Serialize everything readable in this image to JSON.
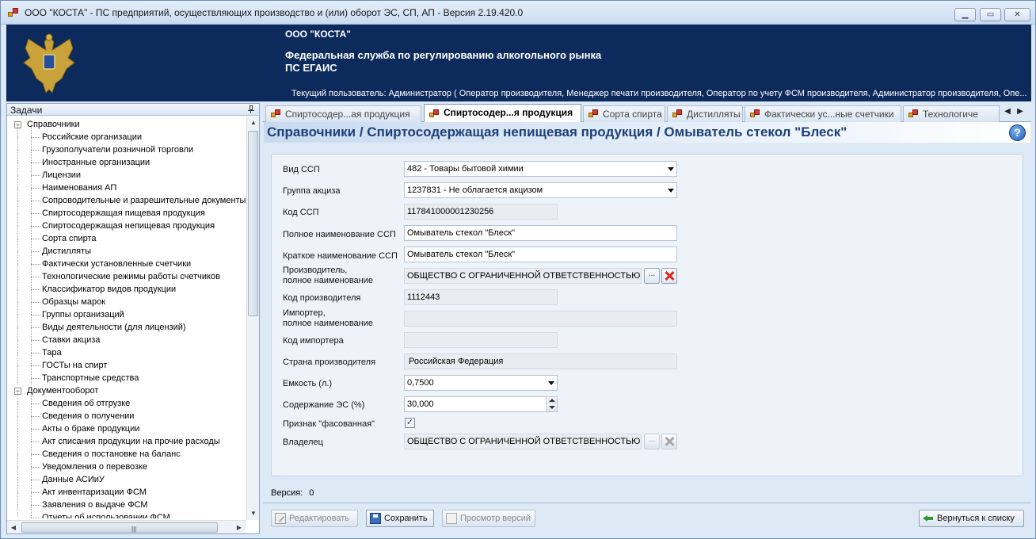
{
  "window": {
    "title": "ООО \"КОСТА\" - ПС предприятий, осуществляющих производство и (или) оборот ЭС, СП, АП - Версия 2.19.420.0",
    "min_label": "▁",
    "max_label": "▭",
    "close_label": "✕"
  },
  "header": {
    "company": "ООО \"КОСТА\"",
    "agency": "Федеральная служба по регулированию алкогольного рынка",
    "system": "ПС ЕГАИС",
    "current_user": "Текущий пользователь: Администратор ( Оператор производителя, Менеджер печати производителя, Оператор по учету ФСМ производителя, Администратор производителя, Опе..."
  },
  "tasks": {
    "title": "Задачи",
    "groups": [
      {
        "label": "Справочники",
        "expander": "−",
        "items": [
          "Российские организации",
          "Грузополучатели розничной торговли",
          "Иностранные организации",
          "Лицензии",
          "Наименования АП",
          "Сопроводительные и разрешительные документы",
          "Спиртосодержащая пищевая продукция",
          "Спиртосодержащая непищевая продукция",
          "Сорта спирта",
          "Дистилляты",
          "Фактически установленные счетчики",
          "Технологические режимы работы счетчиков",
          "Классификатор видов продукции",
          "Образцы марок",
          "Группы организаций",
          "Виды деятельности (для лицензий)",
          "Ставки акциза",
          "Тара",
          "ГОСТы на спирт",
          "Транспортные средства"
        ]
      },
      {
        "label": "Документооборот",
        "expander": "−",
        "items": [
          "Сведения об отгрузке",
          "Сведения о получении",
          "Акты о браке продукции",
          "Акт списания продукции на прочие расходы",
          "Сведения о постановке на баланс",
          "Уведомления о перевозке",
          "Данные АСИиУ",
          "Акт инвентаризации ФСМ",
          "Заявления о выдаче ФСМ",
          "Отчеты об использовании ФСМ"
        ]
      }
    ],
    "scroll": {
      "up": "▲",
      "down": "▼",
      "left": "◀",
      "right": "▶",
      "grip": "|||"
    }
  },
  "tabs": [
    {
      "label": "Спиртосодер...ая продукция",
      "active": false
    },
    {
      "label": "Спиртосодер...я продукция",
      "active": true
    },
    {
      "label": "Сорта спирта",
      "active": false
    },
    {
      "label": "Дистилляты",
      "active": false
    },
    {
      "label": "Фактически ус...ные счетчики",
      "active": false
    },
    {
      "label": "Технологиче",
      "active": false
    }
  ],
  "tab_nav": {
    "prev": "◀",
    "next": "▶"
  },
  "breadcrumb": "Справочники / Спиртосодержащая непищевая продукция / Омыватель стекол \"Блеск\"",
  "help_label": "?",
  "form": {
    "vid_ssp": {
      "label": "Вид ССП",
      "value": "482 - Товары бытовой химии"
    },
    "gruppa_akciza": {
      "label": "Группа акциза",
      "value": "1237831 - Не облагается акцизом"
    },
    "kod_ssp": {
      "label": "Код ССП",
      "value": "117841000001230256"
    },
    "full_name": {
      "label": "Полное наименование ССП",
      "value": "Омыватель стекол \"Блеск\""
    },
    "short_name": {
      "label": "Краткое наименование ССП",
      "value": "Омыватель стекол \"Блеск\""
    },
    "producer": {
      "label_1": "Производитель,",
      "label_2": "полное наименование",
      "value": "ОБЩЕСТВО С ОГРАНИЧЕННОЙ ОТВЕТСТВЕННОСТЬЮ \"КОСТА\"",
      "browse_label": "..."
    },
    "producer_code": {
      "label": "Код производителя",
      "value": "1112443"
    },
    "importer": {
      "label_1": "Импортер,",
      "label_2": "полное наименование",
      "value": ""
    },
    "importer_code": {
      "label": "Код импортера",
      "value": ""
    },
    "country": {
      "label": "Страна производителя",
      "value": "Российская Федерация"
    },
    "capacity": {
      "label": "Емкость (л.)",
      "value": "0,7500"
    },
    "es_content": {
      "label": "Содержание ЭС (%)",
      "value": "30,000"
    },
    "packaged": {
      "label": "Признак \"фасованная\"",
      "checked": true,
      "check_glyph": "✓"
    },
    "owner": {
      "label": "Владелец",
      "value": "ОБЩЕСТВО С ОГРАНИЧЕННОЙ ОТВЕТСТВЕННОСТЬЮ \"КОСТА\"",
      "browse_label": "..."
    }
  },
  "version": {
    "label": "Версия:",
    "value": "0"
  },
  "footer": {
    "edit_label": "Редактировать",
    "save_label": "Сохранить",
    "versions_label": "Просмотр версий",
    "back_label": "Вернуться к списку"
  }
}
